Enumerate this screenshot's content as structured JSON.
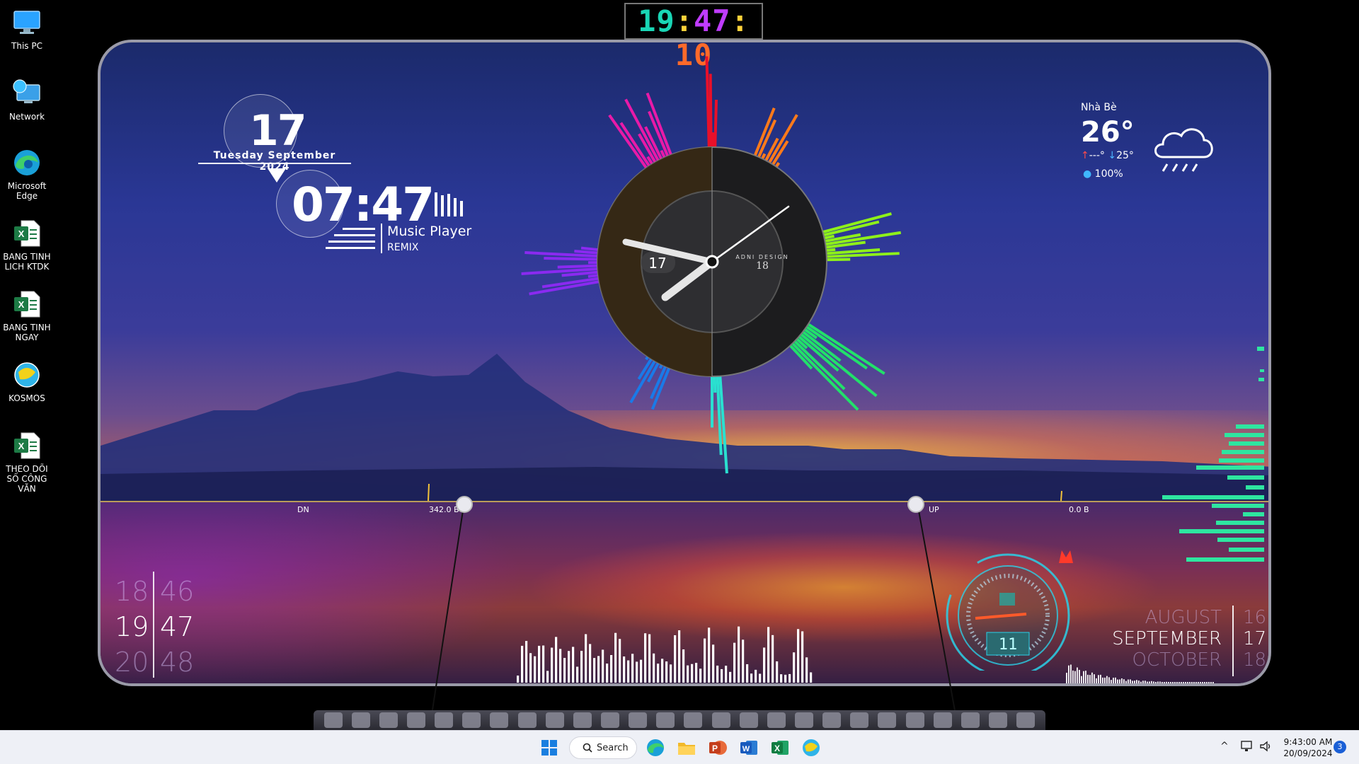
{
  "desktop_icons": [
    {
      "label": "This PC",
      "icon": "computer-icon"
    },
    {
      "label": "Network",
      "icon": "network-icon"
    },
    {
      "label": "Microsoft Edge",
      "icon": "edge-icon"
    },
    {
      "label": "BANG TINH LICH KTDK",
      "icon": "excel-file-icon"
    },
    {
      "label": "BANG TINH NGAY",
      "icon": "excel-file-icon"
    },
    {
      "label": "KOSMOS",
      "icon": "kosmos-icon"
    },
    {
      "label": "THEO DÕI SỐ CÔNG VĂN",
      "icon": "excel-file-icon"
    }
  ],
  "top_clock": {
    "h": "19",
    "sep1": ":",
    "m": "47",
    "sep2": ":",
    "s": "10",
    "colors": {
      "h": "#19d6b5",
      "m": "#c03cff",
      "s": "#ff6a2a",
      "sep": "#ffd23a"
    }
  },
  "date_widget": {
    "day": "17",
    "date_line": "Tuesday September 2024",
    "time": "07:47"
  },
  "music_player": {
    "title": "Music Player",
    "subtitle": "REMIX"
  },
  "weather": {
    "location": "Nhà Bè",
    "temp": "26°",
    "high": "---°",
    "low": "25°",
    "humidity": "100%",
    "icon": "cloud-rain-icon"
  },
  "analog_clock": {
    "date_badge": "17",
    "brand": "ADNI DESIGN",
    "brand_num": "18"
  },
  "network": {
    "down_label": "DN",
    "down_value": "342.0 B",
    "up_label": "UP",
    "up_value": "0.0 B"
  },
  "time_column": {
    "hours": [
      "18",
      "19",
      "20"
    ],
    "minutes": [
      "46",
      "47",
      "48"
    ]
  },
  "month_column": {
    "months": [
      "AUGUST",
      "SEPTEMBER",
      "OCTOBER"
    ],
    "days": [
      "16",
      "17",
      "18"
    ]
  },
  "speedo": {
    "value": "11"
  },
  "taskbar": {
    "search_label": "Search",
    "apps": [
      "windows-start-icon",
      "edge-icon",
      "file-explorer-icon",
      "powerpoint-icon",
      "word-icon",
      "excel-icon",
      "kosmos-icon"
    ],
    "tray_time": "9:43:00 AM",
    "tray_date": "20/09/2024",
    "notif_count": "3"
  },
  "colors": {
    "accent_green": "#2ee6a0",
    "frame": "#9a9aa8",
    "clock_red": "#e8102a"
  }
}
